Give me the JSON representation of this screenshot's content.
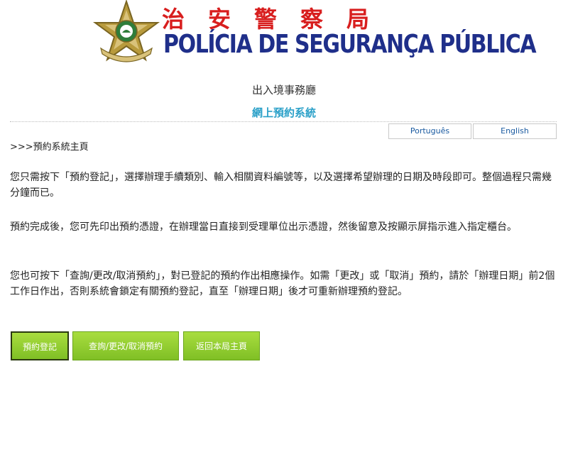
{
  "header": {
    "title_cn": "治安警察局",
    "title_pt": "POLÍCIA DE SEGURANÇA PÚBLICA",
    "emblem_icon": "psp-star-emblem-icon"
  },
  "department": "出入境事務廳",
  "system_title": "網上預約系統",
  "languages": {
    "portuguese": "Português",
    "english": "English"
  },
  "breadcrumb": ">>>預約系統主頁",
  "paragraphs": [
    "您只需按下「預約登記」，選擇辦理手續類別、輸入相關資料編號等，以及選擇希望辦理的日期及時段即可。整個過程只需幾分鐘而已。",
    "預約完成後，您可先印出預約憑證，在辦理當日直接到受理單位出示憑證，然後留意及按顯示屏指示進入指定櫃台。",
    "您也可按下「查詢/更改/取消預約」，對已登記的預約作出相應操作。如需「更改」或「取消」預約，請於「辦理日期」前2個工作日作出，否則系統會鎖定有關預約登記，直至「辦理日期」後才可重新辦理預約登記。"
  ],
  "buttons": {
    "book": "預約登記",
    "query": "查詢/更改/取消預約",
    "home": "返回本局主頁"
  },
  "colors": {
    "title_cn": "#d81e1e",
    "title_pt": "#1f2f8a",
    "system_title": "#2aa0c8",
    "button_green": "#8fcc2c"
  }
}
